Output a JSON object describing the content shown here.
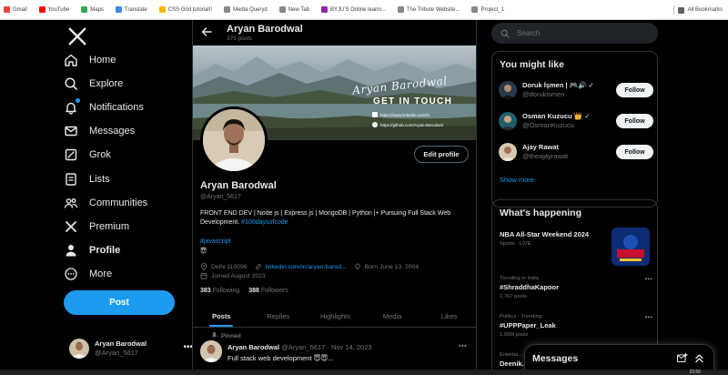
{
  "bookmarks": {
    "items": [
      {
        "label": "Gmail",
        "color": "#ea4335"
      },
      {
        "label": "YouTube",
        "color": "#ff0000"
      },
      {
        "label": "Maps",
        "color": "#34a853"
      },
      {
        "label": "Translate",
        "color": "#4285f4"
      },
      {
        "label": "CSS Grid tutorial!!",
        "color": "#f4b400"
      },
      {
        "label": "Media Queryd",
        "color": "#888888"
      },
      {
        "label": "New Tab",
        "color": "#888888"
      },
      {
        "label": "BYJU'S Online learni...",
        "color": "#8e24aa"
      },
      {
        "label": "The Tribute Website...",
        "color": "#888888"
      },
      {
        "label": "Project_1",
        "color": "#888888"
      }
    ],
    "all_label": "All Bookmarks"
  },
  "nav": {
    "items": [
      {
        "label": "Home",
        "icon": "home-icon"
      },
      {
        "label": "Explore",
        "icon": "search-icon"
      },
      {
        "label": "Notifications",
        "icon": "bell-icon"
      },
      {
        "label": "Messages",
        "icon": "mail-icon"
      },
      {
        "label": "Grok",
        "icon": "grok-icon"
      },
      {
        "label": "Lists",
        "icon": "list-icon"
      },
      {
        "label": "Communities",
        "icon": "communities-icon"
      },
      {
        "label": "Premium",
        "icon": "x-icon"
      },
      {
        "label": "Profile",
        "icon": "user-icon"
      },
      {
        "label": "More",
        "icon": "more-icon"
      }
    ],
    "post_label": "Post"
  },
  "account": {
    "name": "Aryan Barodwal",
    "handle": "@Aryan_5617"
  },
  "header": {
    "name": "Aryan Barodwal",
    "posts_count": "375 posts"
  },
  "banner": {
    "script_text": "Aryan Barodwal",
    "headline": "GET IN TOUCH",
    "linkedin": "https://www.linkedin.com/in",
    "github": "https://github.com/Aryan-Barodwal"
  },
  "profile": {
    "name": "Aryan Barodwal",
    "handle": "@Aryan_5617",
    "edit_label": "Edit profile",
    "bio_text": "FRONT END DEV | Node js | Express js | MongoDB | Python |+ Pursuing Full Stack Web Development. ",
    "bio_link": "#100daysofcode",
    "hashtag": "#javascript",
    "emoji": "😇",
    "location": "Delhi 110096",
    "website": "linkedin.com/in/aryan-barod...",
    "born": "Born June 13, 2004",
    "joined": "Joined August 2023",
    "following_count": "383",
    "following_label": "Following",
    "followers_count": "388",
    "followers_label": "Followers"
  },
  "tabs": [
    "Posts",
    "Replies",
    "Highlights",
    "Media",
    "Likes"
  ],
  "pinned_tweet": {
    "pinned_label": "Pinned",
    "name": "Aryan Barodwal",
    "handle": "@Aryan_5617",
    "date": "Nov 14, 2023",
    "text": "Full stack web development 😇😇..."
  },
  "right": {
    "search_placeholder": "Search",
    "you_might_like": "You might like",
    "suggestions": [
      {
        "name": "Doruk İşmen | 🎮🔊 ✓",
        "handle": "@dorukismen",
        "follow": "Follow"
      },
      {
        "name": "Osman Kuzucu 👑 ✓",
        "handle": "@OsmanKuzucu",
        "follow": "Follow"
      },
      {
        "name": "Ajay Rawat",
        "handle": "@theajayrawat",
        "follow": "Follow"
      }
    ],
    "show_more": "Show more",
    "whats_happening": "What's happening",
    "trends": [
      {
        "category": "",
        "title": "NBA All-Star Weekend 2024",
        "sub": "Sports · LIVE"
      },
      {
        "category": "Trending in India",
        "title": "#ShraddhaKapoor",
        "sub": "1,767 posts"
      },
      {
        "category": "Politics · Trending",
        "title": "#UPPPaper_Leak",
        "sub": "1.09M posts"
      },
      {
        "category": "Entertai...",
        "title": "Deenik...",
        "sub": ""
      }
    ]
  },
  "messages": {
    "title": "Messages"
  },
  "system": {
    "time": "23:56"
  },
  "colors": {
    "accent": "#1d9bf0",
    "background": "#000000",
    "border": "#2f3336",
    "muted": "#71767b"
  }
}
